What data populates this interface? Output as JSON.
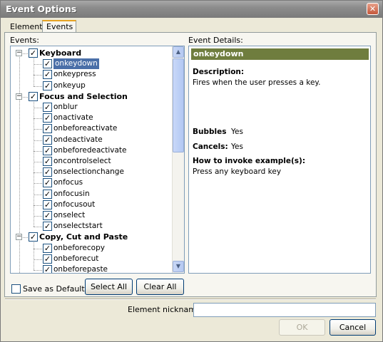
{
  "window": {
    "title": "Event Options",
    "close_glyph": "✕"
  },
  "tabs": [
    {
      "label": "Element"
    },
    {
      "label": "Events"
    }
  ],
  "events_label": "Events:",
  "details_label": "Event Details:",
  "tree": {
    "groups": [
      {
        "label": "Keyboard",
        "checked": true,
        "items": [
          "onkeydown",
          "onkeypress",
          "onkeyup"
        ]
      },
      {
        "label": "Focus and Selection",
        "checked": true,
        "items": [
          "onblur",
          "onactivate",
          "onbeforeactivate",
          "ondeactivate",
          "onbeforedeactivate",
          "oncontrolselect",
          "onselectionchange",
          "onfocus",
          "onfocusin",
          "onfocusout",
          "onselect",
          "onselectstart"
        ]
      },
      {
        "label": "Copy, Cut and Paste",
        "checked": true,
        "items": [
          "onbeforecopy",
          "onbeforecut",
          "onbeforepaste"
        ]
      }
    ],
    "selected_item": "onkeydown",
    "expander_glyph": "−",
    "check_glyph": "✓"
  },
  "details": {
    "event_name": "onkeydown",
    "description_label": "Description:",
    "description_text": "Fires when the user presses a key.",
    "bubbles_label": "Bubbles",
    "bubbles_value": "Yes",
    "cancels_label": "Cancels:",
    "cancels_value": "Yes",
    "howto_label": "How to invoke example(s):",
    "howto_text": "Press any keyboard key"
  },
  "save_default_label": "Save as Default",
  "save_default_checked": false,
  "buttons": {
    "select_all": "Select All",
    "clear_all": "Clear All",
    "ok": "OK",
    "cancel": "Cancel"
  },
  "nickname_label": "Element nickname:",
  "nickname_value": "",
  "colors": {
    "selection": "#4a6fa8",
    "details_header": "#6f7d3e",
    "tab_accent": "#e6a324"
  }
}
